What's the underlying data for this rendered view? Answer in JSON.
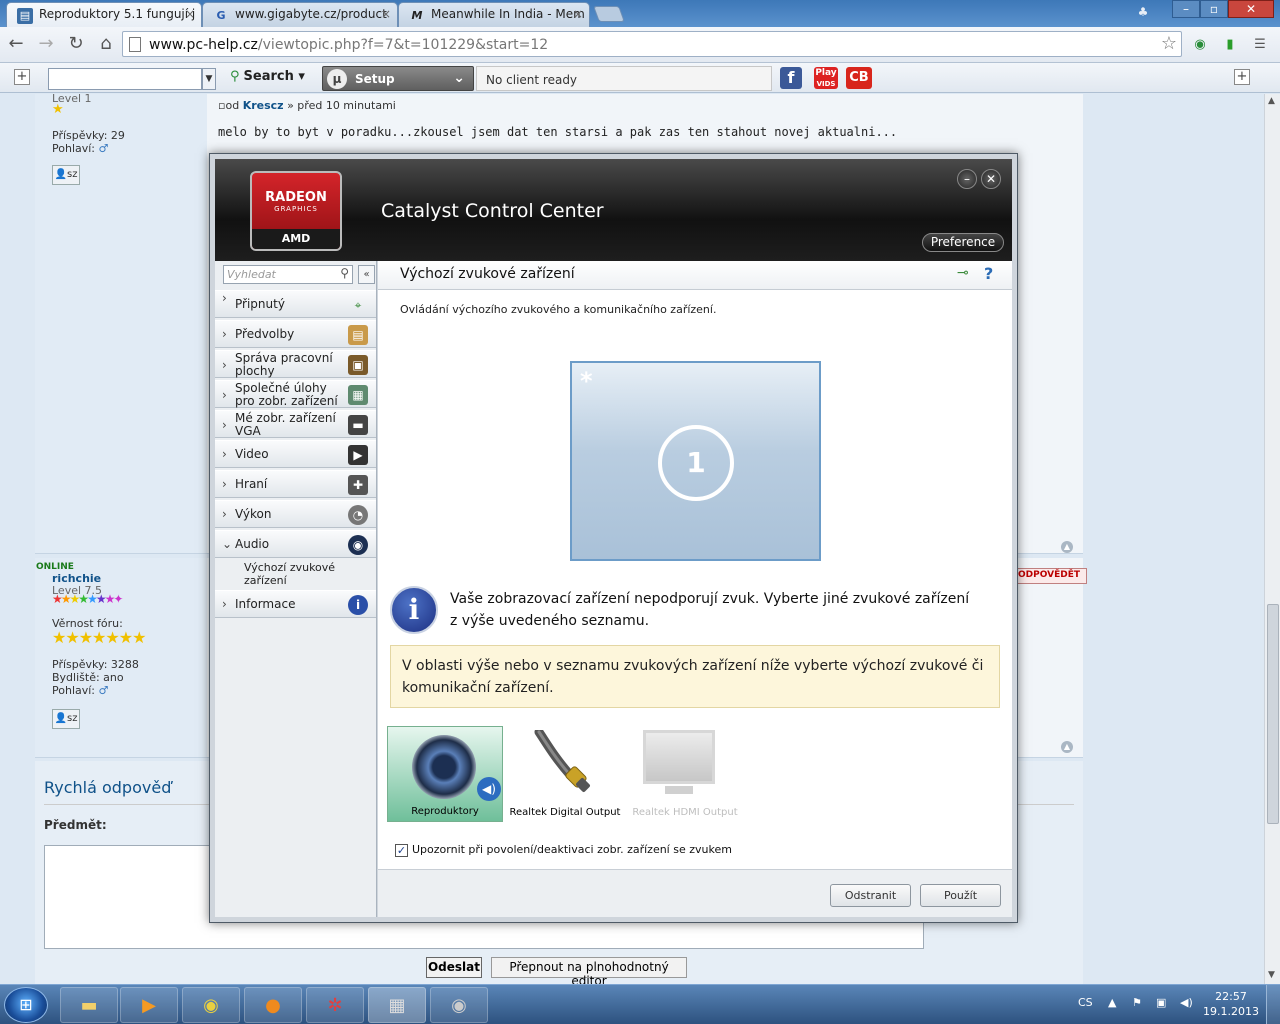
{
  "browser": {
    "tabs": [
      {
        "title": "Reproduktory 5.1 fungují j",
        "icon": "forum-icon"
      },
      {
        "title": "www.gigabyte.cz/product",
        "icon": "gigabyte-icon"
      },
      {
        "title": "Meanwhile In India - Mem",
        "icon": "meme-icon"
      }
    ],
    "url_host": "www.pc-help.cz",
    "url_tail": "/viewtopic.php?f=7&t=101229&start=12"
  },
  "toolbar": {
    "search_label": "Search",
    "setup_label": "Setup",
    "client_status": "No client ready",
    "play_label": "Play",
    "play_sub": "VIDS",
    "cb_label": "CB"
  },
  "forum": {
    "post1": {
      "level": "Level 1",
      "posts_label": "Příspěvky:",
      "posts": "29",
      "gender_label": "Pohlaví:",
      "pm": "sz",
      "meta_prefix": "od",
      "author": "Krescz",
      "time": "» před 10 minutami",
      "text": "melo by to byt v poradku...zkousel jsem dat ten starsi a pak zas ten stahout novej aktualni..."
    },
    "post2": {
      "online": "ONLINE",
      "author": "richchie",
      "level": "Level 7.5",
      "loyalty_label": "Věrnost fóru:",
      "posts_label": "Příspěvky:",
      "posts": "3288",
      "residence_label": "Bydliště:",
      "residence": "ano",
      "gender_label": "Pohlaví:",
      "pm": "sz",
      "reply": "ODPOVĚDĚT"
    },
    "quick_reply": {
      "title": "Rychlá odpověď",
      "subject_label": "Předmět:",
      "send": "Odeslat",
      "editor": "Přepnout na plnohodnotný editor"
    }
  },
  "ccc": {
    "brand_top": "RADEON",
    "brand_sub": "GRAPHICS",
    "brand_amd": "AMD",
    "title": "Catalyst Control Center",
    "preference": "Preference",
    "search_placeholder": "Vyhledat",
    "nav": [
      {
        "label": "Připnutý",
        "icon": "pin-icon"
      },
      {
        "label": "Předvolby",
        "icon": "presets-icon"
      },
      {
        "label": "Správa pracovní plochy",
        "icon": "desktop-icon"
      },
      {
        "label": "Společné úlohy pro zobr. zařízení",
        "icon": "display-tasks-icon"
      },
      {
        "label": "Mé zobr. zařízení VGA",
        "icon": "vga-icon"
      },
      {
        "label": "Video",
        "icon": "video-icon"
      },
      {
        "label": "Hraní",
        "icon": "gamepad-icon"
      },
      {
        "label": "Výkon",
        "icon": "gauge-icon"
      },
      {
        "label": "Audio",
        "icon": "speaker-icon"
      },
      {
        "label": "Informace",
        "icon": "info-icon"
      }
    ],
    "audio_sub": "Výchozí zvukové zařízení",
    "main_title": "Výchozí zvukové zařízení",
    "main_desc": "Ovládání výchozího zvukového a komunikačního zařízení.",
    "display_number": "1",
    "info_text": "Vaše zobrazovací zařízení nepodporují zvuk. Vyberte jiné zvukové zařízení z výše uvedeného seznamu.",
    "hint_text": "V oblasti výše nebo v seznamu zvukových zařízení níže vyberte výchozí zvukové či komunikační zařízení.",
    "devices": [
      {
        "label": "Reproduktory",
        "selected": true
      },
      {
        "label": "Realtek Digital Output",
        "selected": false
      },
      {
        "label": "Realtek HDMI Output",
        "selected": false
      }
    ],
    "notify_checkbox": "Upozornit při povolení/deaktivaci zobr. zařízení se zvukem",
    "notify_checked": true,
    "btn_remove": "Odstranit",
    "btn_apply": "Použít"
  },
  "taskbar": {
    "lang": "CS",
    "time": "22:57",
    "date": "19.1.2013"
  }
}
